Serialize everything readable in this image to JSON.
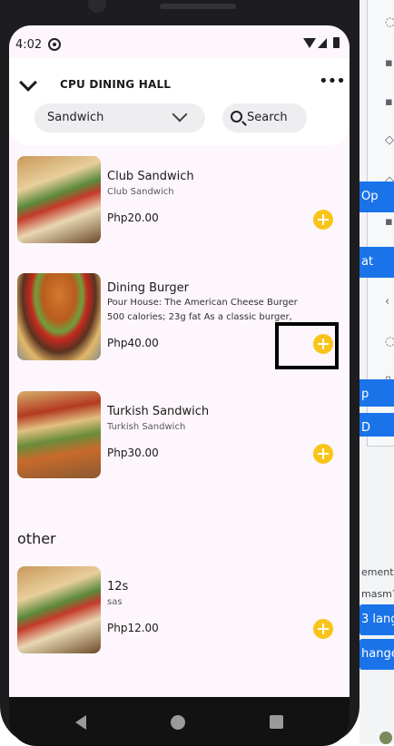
{
  "status_bar": {
    "time": "4:02"
  },
  "header": {
    "title": "CPU DINING HALL",
    "category": "Sandwich",
    "search_label": "Search"
  },
  "items": [
    {
      "name": "Club Sandwich",
      "subtitle": "Club Sandwich",
      "price": "Php20.00"
    },
    {
      "name": "Dining Burger",
      "subtitle": "Pour House: The American Cheese Burger 500 calories; 23g fat As a classic burger,",
      "price": "Php40.00"
    },
    {
      "name": "Turkish Sandwich",
      "subtitle": "Turkish Sandwich",
      "price": "Php30.00"
    }
  ],
  "other_section": {
    "title": "other",
    "items": [
      {
        "name": "12s",
        "subtitle": "sas",
        "price": "Php12.00"
      }
    ]
  },
  "background": {
    "blue_1": "Op",
    "blue_2": "at",
    "blue_3": "p",
    "blue_4": "D",
    "label_1": "ement",
    "label_2": "masm?",
    "button_1": "3 lang",
    "button_2": "hange"
  },
  "colors": {
    "accent": "#f9c41a",
    "screen_bg": "#fdf6fc"
  }
}
